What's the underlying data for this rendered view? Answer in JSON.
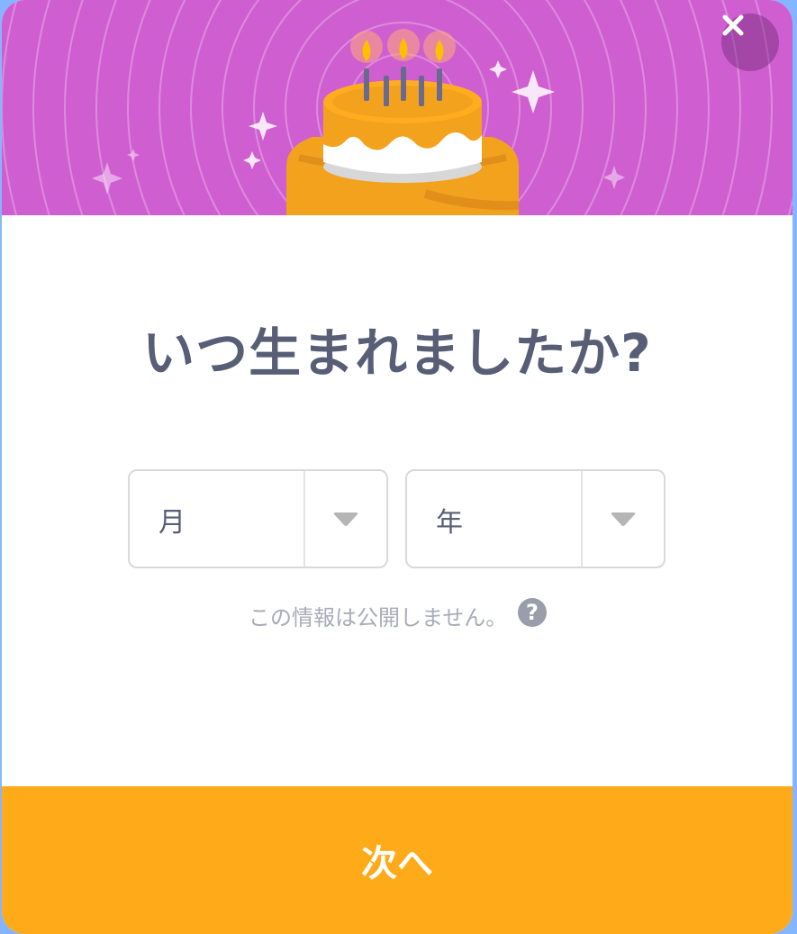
{
  "modal": {
    "title": "いつ生まれましたか?",
    "close_icon": "close-icon",
    "month_select": {
      "selected": "月",
      "icon": "caret-down-icon"
    },
    "year_select": {
      "selected": "年",
      "icon": "caret-down-icon"
    },
    "privacy_note": "この情報は公開しません。",
    "help_icon": {
      "name": "question-icon",
      "glyph": "?"
    },
    "next_button": "次へ"
  },
  "colors": {
    "banner": "#cf5fd0",
    "accent": "#ffab19",
    "title_text": "#575e75",
    "cake": "#f3a21e"
  }
}
